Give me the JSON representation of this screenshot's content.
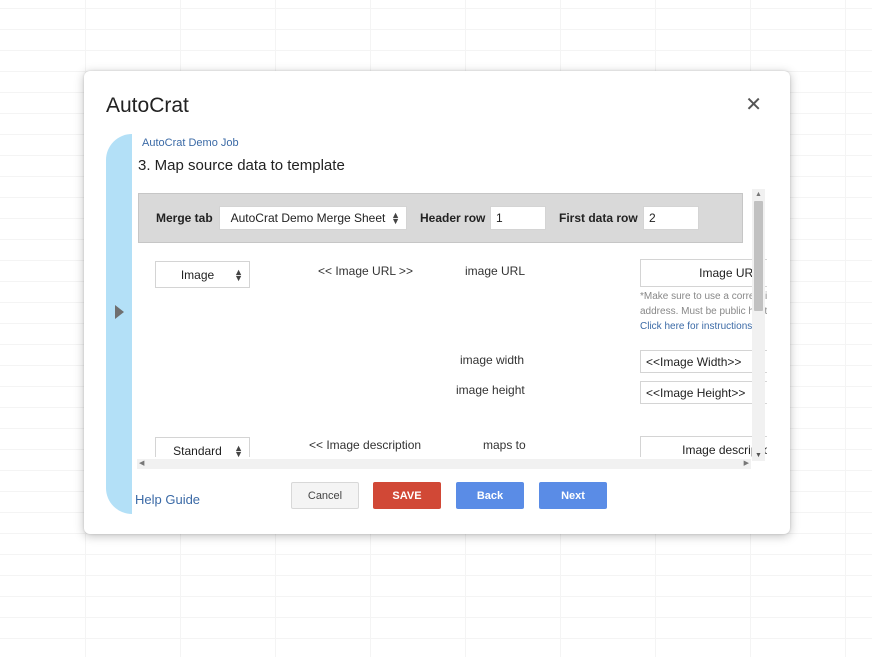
{
  "dialog": {
    "title": "AutoCrat",
    "job_name": "AutoCrat Demo Job",
    "step_title": "3. Map source data to template",
    "help_label": "Help Guide"
  },
  "merge": {
    "tab_label": "Merge tab",
    "tab_value": "AutoCrat Demo Merge Sheet",
    "header_row_label": "Header row",
    "header_row_value": "1",
    "first_data_row_label": "First data row",
    "first_data_row_value": "2"
  },
  "mappings": [
    {
      "type": "Image",
      "tag": "<< Image URL >>",
      "fields": [
        {
          "label": "image URL",
          "value": "Image URL",
          "note": "*Make sure to use a correct image address. Must be public hosted.",
          "link": "Click here for instructions."
        },
        {
          "label": "image width",
          "value": "<<Image Width>>"
        },
        {
          "label": "image height",
          "value": "<<Image Height>>"
        }
      ]
    },
    {
      "type": "Standard",
      "tag": "<< Image description",
      "fields": [
        {
          "label": "maps to",
          "value": "Image description"
        }
      ]
    }
  ],
  "buttons": {
    "cancel": "Cancel",
    "save": "SAVE",
    "back": "Back",
    "next": "Next"
  },
  "colors": {
    "save": "#d14836",
    "primary": "#5a8ce6",
    "side_tab": "#b3e0f7",
    "link": "#3b6aa6"
  }
}
